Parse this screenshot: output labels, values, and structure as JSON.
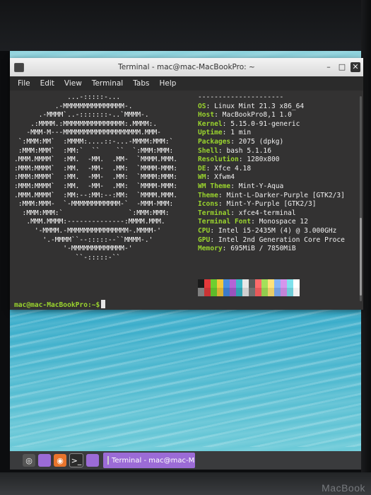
{
  "window": {
    "title": "Terminal - mac@mac-MacBookPro: ~",
    "controls": [
      "–",
      "□",
      "✕"
    ]
  },
  "menu": [
    "File",
    "Edit",
    "View",
    "Terminal",
    "Tabs",
    "Help"
  ],
  "neofetch": {
    "logo_lines": [
      "             ...-:::::-...",
      "          .-MMMMMMMMMMMMMMM-.",
      "      .-MMMM`..-:::::::-..`MMMM-.",
      "    .:MMMM.:MMMMMMMMMMMMMMM:.MMMM:.",
      "   -MMM-M---MMMMMMMMMMMMMMMMMMM.MMM-",
      " `:MMM:MM`  :MMMM:....::-...-MMMM:MMM:`",
      " :MMM:MMM`  :MM:`  ``    ``  `:MMM:MMM:",
      ".MMM.MMMM`  :MM.  -MM.  .MM-  `MMMM.MMM.",
      ":MMM:MMMM`  :MM.  -MM-  .MM:  `MMMM-MMM:",
      ":MMM:MMMM`  :MM.  -MM-  .MM:  `MMMM:MMM:",
      ":MMM:MMMM`  :MM.  -MM-  .MM:  `MMMM-MMM:",
      ".MMM.MMMM`  :MM:--:MM:--:MM:  `MMMM.MMM.",
      " :MMM:MMM-  `-MMMMMMMMMMMM-`  -MMM-MMM:",
      "  :MMM:MMM:`                `:MMM:MMM:",
      "   .MMM.MMMM:--------------:MMMM.MMM.",
      "     '-MMMM.-MMMMMMMMMMMMMMM-.MMMM-'",
      "       '.-MMMM``--:::::--``MMMM-.'",
      "            '-MMMMMMMMMMMMM-'",
      "               ``-:::::-``"
    ],
    "separator": "---------------------",
    "info": [
      {
        "key": "OS",
        "value": "Linux Mint 21.3 x86_64"
      },
      {
        "key": "Host",
        "value": "MacBookPro8,1 1.0"
      },
      {
        "key": "Kernel",
        "value": "5.15.0-91-generic"
      },
      {
        "key": "Uptime",
        "value": "1 min"
      },
      {
        "key": "Packages",
        "value": "2075 (dpkg)"
      },
      {
        "key": "Shell",
        "value": "bash 5.1.16"
      },
      {
        "key": "Resolution",
        "value": "1280x800"
      },
      {
        "key": "DE",
        "value": "Xfce 4.18"
      },
      {
        "key": "WM",
        "value": "Xfwm4"
      },
      {
        "key": "WM Theme",
        "value": "Mint-Y-Aqua"
      },
      {
        "key": "Theme",
        "value": "Mint-L-Darker-Purple [GTK2/3]"
      },
      {
        "key": "Icons",
        "value": "Mint-Y-Purple [GTK2/3]"
      },
      {
        "key": "Terminal",
        "value": "xfce4-terminal"
      },
      {
        "key": "Terminal Font",
        "value": "Monospace 12"
      },
      {
        "key": "CPU",
        "value": "Intel i5-2435M (4) @ 3.000GHz"
      },
      {
        "key": "GPU",
        "value": "Intel 2nd Generation Core Proce"
      },
      {
        "key": "Memory",
        "value": "695MiB / 7850MiB"
      }
    ],
    "palette_top": [
      "#1a1a1a",
      "#e5393a",
      "#6fcf2f",
      "#f3c83c",
      "#4a8fe0",
      "#b363d6",
      "#3fb7c9",
      "#e8e8e8",
      "#5a5a5a",
      "#ff6b6b",
      "#a4e05a",
      "#ffe27a",
      "#83b4f5",
      "#d595ec",
      "#7fe1ec",
      "#ffffff"
    ],
    "palette_bottom": [
      "#808080",
      "#c93434",
      "#5dbb2a",
      "#d8b034",
      "#3c7ac8",
      "#9a53bd",
      "#33a0b0",
      "#d0d0d0",
      "#707070",
      "#e85959",
      "#92cc4e",
      "#e8cd69",
      "#739fe0",
      "#c284d8",
      "#6dcbd6",
      "#f0f0f0"
    ]
  },
  "prompt": {
    "user": "mac@mac-MacBookPro:~$",
    "command": ""
  },
  "taskbar": {
    "task_label": "Terminal - mac@mac-Mac..."
  },
  "bezel": {
    "label": "MacBook"
  }
}
